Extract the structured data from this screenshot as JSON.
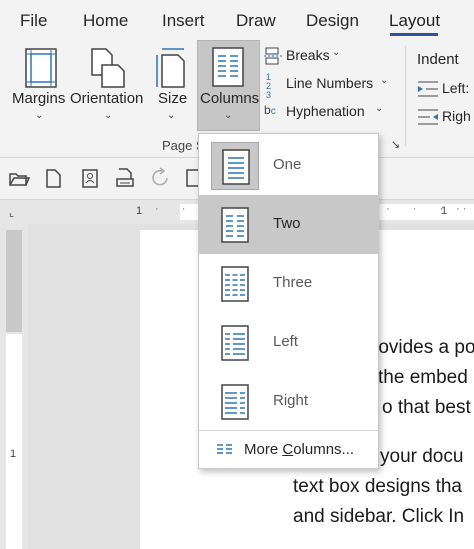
{
  "tabs": [
    {
      "label": "File"
    },
    {
      "label": "Home"
    },
    {
      "label": "Insert"
    },
    {
      "label": "Draw"
    },
    {
      "label": "Design"
    },
    {
      "label": "Layout"
    }
  ],
  "ribbon": {
    "margins": "Margins",
    "orientation": "Orientation",
    "size": "Size",
    "columns": "Columns",
    "breaks": "Breaks",
    "line_numbers": "Line Numbers",
    "hyphenation": "Hyphenation",
    "indent": "Indent",
    "left": "Left:",
    "right": "Righ",
    "page_setup_group": "Page S"
  },
  "dropdown": {
    "items": [
      {
        "label": "One"
      },
      {
        "label": "Two"
      },
      {
        "label": "Three"
      },
      {
        "label": "Left"
      },
      {
        "label": "Right"
      }
    ],
    "more_columns_pre": "More ",
    "more_columns_u": "C",
    "more_columns_post": "olumns..."
  },
  "document": {
    "lines": [
      "rovides a po",
      "the embed",
      "o that best",
      "your docu",
      "text box designs tha",
      "and sidebar. Click In"
    ]
  },
  "ruler": {
    "marks": [
      "1",
      "1",
      "1"
    ]
  },
  "colors": {
    "accent": "#2b579a",
    "ribbon_bg": "#f3f3f3",
    "selected": "#c8c8c8",
    "icon_teal": "#2e75b6"
  }
}
